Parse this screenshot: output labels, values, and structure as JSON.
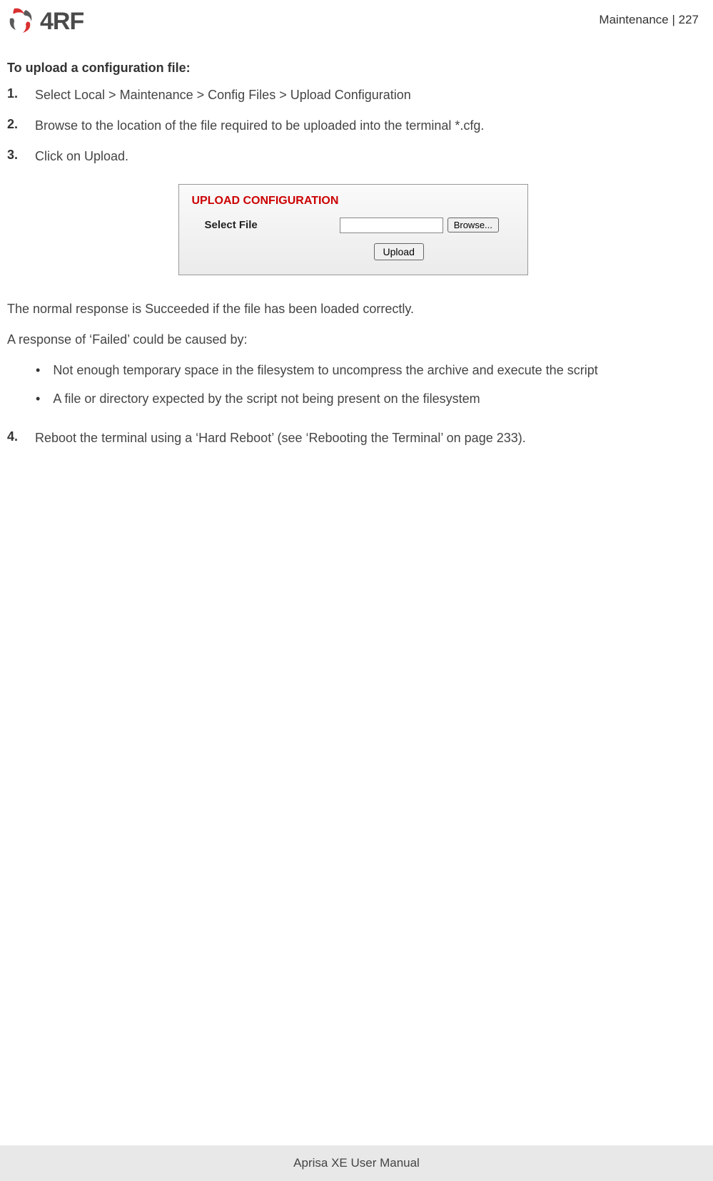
{
  "header": {
    "logo_text": "4RF",
    "page_ref": "Maintenance  |  227"
  },
  "content": {
    "section_title": "To upload a configuration file:",
    "steps": [
      {
        "num": "1.",
        "text": "Select Local > Maintenance > Config Files > Upload Configuration"
      },
      {
        "num": "2.",
        "text": "Browse to the location of the file required to be uploaded into the terminal *.cfg."
      },
      {
        "num": "3.",
        "text": "Click on Upload."
      }
    ],
    "upload_panel": {
      "title": "UPLOAD CONFIGURATION",
      "label": "Select File",
      "browse_btn": "Browse...",
      "upload_btn": "Upload",
      "file_value": ""
    },
    "response_line1": "The normal response is Succeeded if the file has been loaded correctly.",
    "response_line2": "A response of ‘Failed’ could be caused by:",
    "bullets": [
      "Not enough temporary space in the filesystem to uncompress the archive and execute the script",
      "A file or directory expected by the script not being present on the filesystem"
    ],
    "step4": {
      "num": "4.",
      "text": "Reboot the terminal using a ‘Hard Reboot’ (see ‘Rebooting the Terminal’ on page 233)."
    }
  },
  "footer": {
    "text": "Aprisa XE User Manual"
  }
}
